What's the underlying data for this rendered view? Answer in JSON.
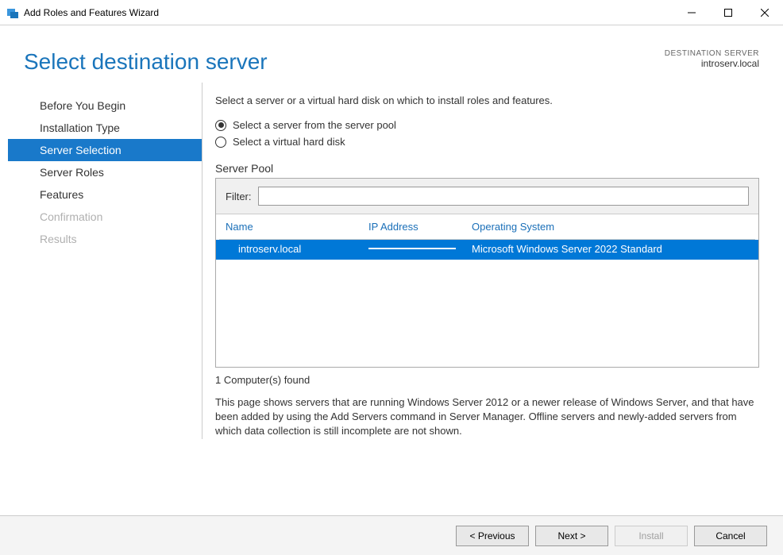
{
  "window": {
    "title": "Add Roles and Features Wizard"
  },
  "header": {
    "page_title": "Select destination server",
    "dest_label": "DESTINATION SERVER",
    "dest_name": "introserv.local"
  },
  "nav": {
    "items": [
      {
        "label": "Before You Begin",
        "state": "normal"
      },
      {
        "label": "Installation Type",
        "state": "normal"
      },
      {
        "label": "Server Selection",
        "state": "active"
      },
      {
        "label": "Server Roles",
        "state": "normal"
      },
      {
        "label": "Features",
        "state": "normal"
      },
      {
        "label": "Confirmation",
        "state": "disabled"
      },
      {
        "label": "Results",
        "state": "disabled"
      }
    ]
  },
  "content": {
    "instruction": "Select a server or a virtual hard disk on which to install roles and features.",
    "radio1": "Select a server from the server pool",
    "radio2": "Select a virtual hard disk",
    "pool_label": "Server Pool",
    "filter_label": "Filter:",
    "filter_value": "",
    "columns": {
      "name": "Name",
      "ip": "IP Address",
      "os": "Operating System"
    },
    "rows": [
      {
        "name": "introserv.local",
        "ip": "",
        "os": "Microsoft Windows Server 2022 Standard"
      }
    ],
    "found_text": "1 Computer(s) found",
    "description": "This page shows servers that are running Windows Server 2012 or a newer release of Windows Server, and that have been added by using the Add Servers command in Server Manager. Offline servers and newly-added servers from which data collection is still incomplete are not shown."
  },
  "footer": {
    "previous": "< Previous",
    "next": "Next >",
    "install": "Install",
    "cancel": "Cancel"
  }
}
